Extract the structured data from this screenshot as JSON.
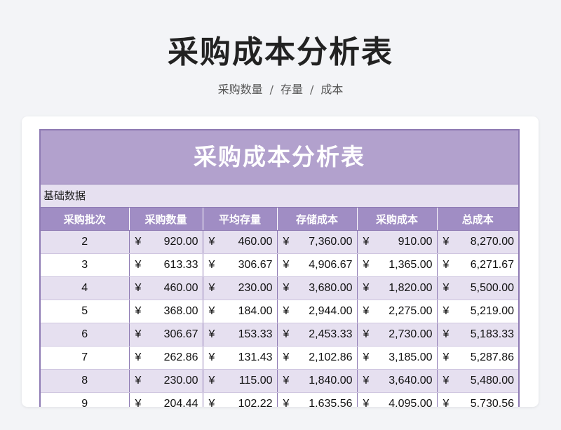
{
  "header": {
    "title": "采购成本分析表",
    "subtitle_parts": [
      "采购数量",
      "存量",
      "成本"
    ],
    "separator": "/"
  },
  "sheet": {
    "title": "采购成本分析表",
    "section_label": "基础数据",
    "columns": [
      "采购批次",
      "采购数量",
      "平均存量",
      "存储成本",
      "采购成本",
      "总成本"
    ],
    "currency_symbol": "¥",
    "rows": [
      [
        "2",
        "920.00",
        "460.00",
        "7,360.00",
        "910.00",
        "8,270.00"
      ],
      [
        "3",
        "613.33",
        "306.67",
        "4,906.67",
        "1,365.00",
        "6,271.67"
      ],
      [
        "4",
        "460.00",
        "230.00",
        "3,680.00",
        "1,820.00",
        "5,500.00"
      ],
      [
        "5",
        "368.00",
        "184.00",
        "2,944.00",
        "2,275.00",
        "5,219.00"
      ],
      [
        "6",
        "306.67",
        "153.33",
        "2,453.33",
        "2,730.00",
        "5,183.33"
      ],
      [
        "7",
        "262.86",
        "131.43",
        "2,102.86",
        "3,185.00",
        "5,287.86"
      ],
      [
        "8",
        "230.00",
        "115.00",
        "1,840.00",
        "3,640.00",
        "5,480.00"
      ],
      [
        "9",
        "204.44",
        "102.22",
        "1,635.56",
        "4,095.00",
        "5,730.56"
      ]
    ]
  },
  "colors": {
    "title_band": "#b2a1cd",
    "header_band": "#a08dc4",
    "alt_row": "#e6e0f0",
    "border": "#8e7ab3"
  }
}
